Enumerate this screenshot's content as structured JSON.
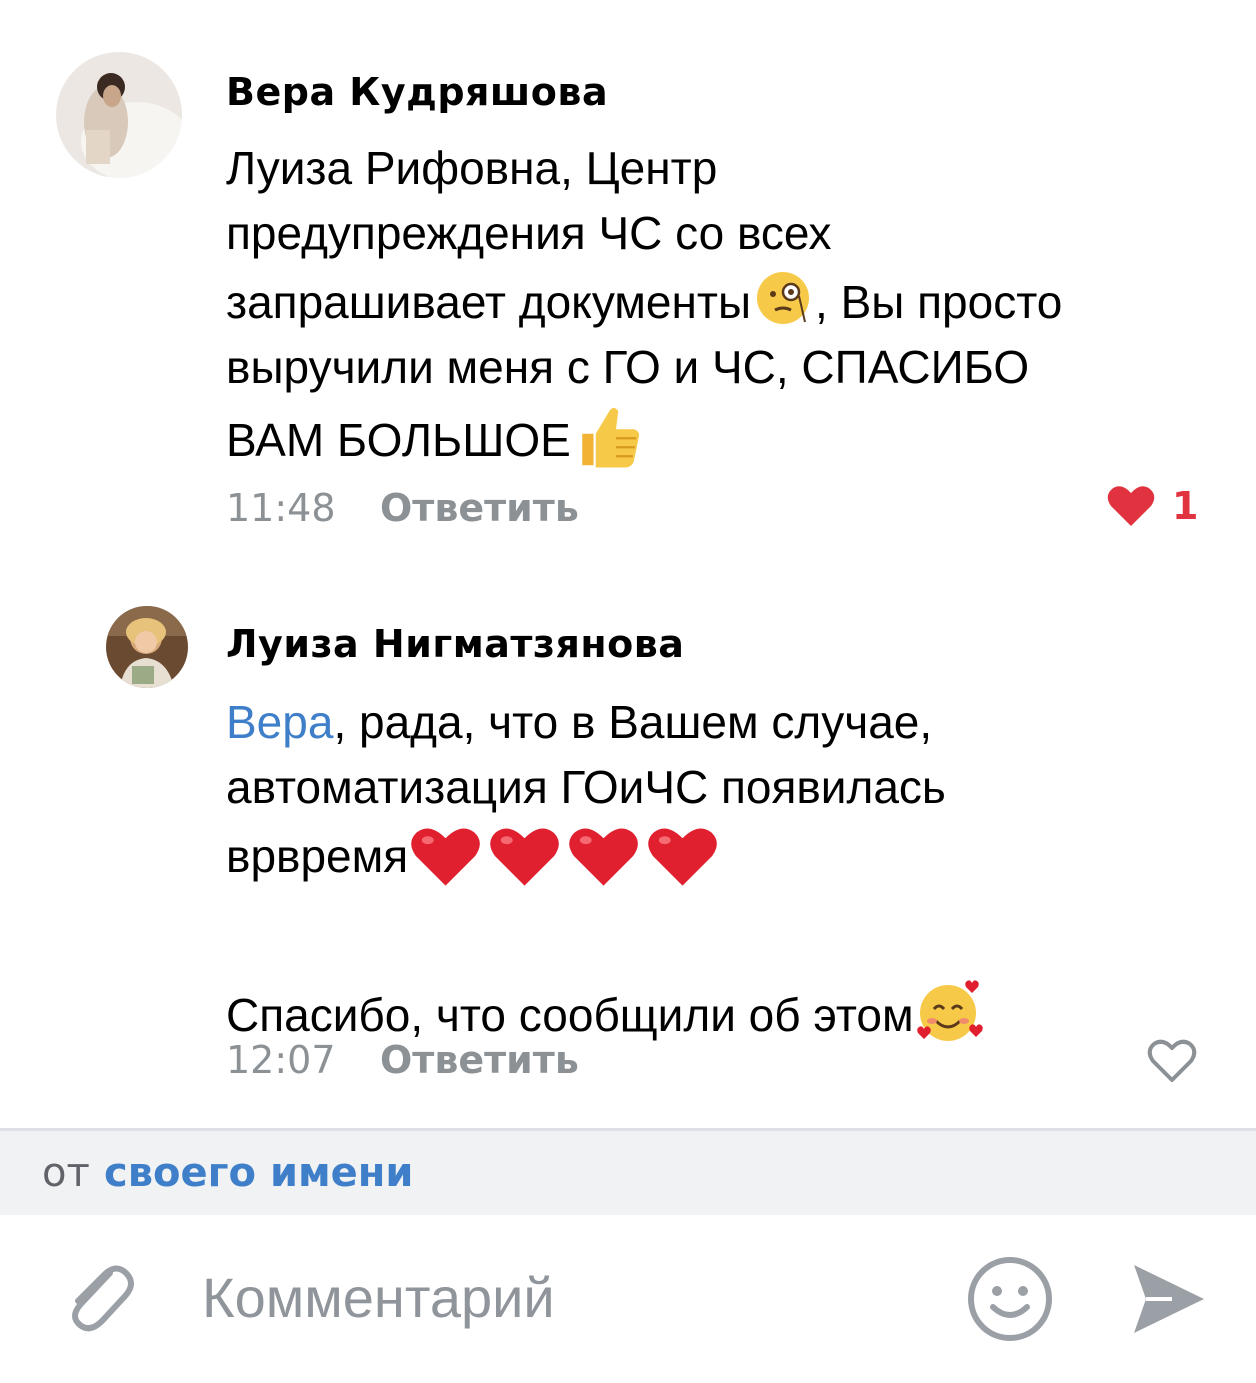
{
  "comments": [
    {
      "author": "Вера Кудряшова",
      "lines": [
        "Луиза Рифовна, Центр",
        "предупреждения ЧС со всех",
        "запрашивает документы",
        ", Вы просто",
        "выручили меня с ГО и ЧС, СПАСИБО",
        "ВАМ БОЛЬШОЕ"
      ],
      "time": "11:48",
      "reply_label": "Ответить",
      "like_count": "1",
      "liked": true,
      "emojis": [
        "face-with-monocle",
        "thumbs-up"
      ]
    },
    {
      "author": "Луиза Нигматзянова",
      "mention": "Вера",
      "lines": [
        ", рада, что в Вашем случае,",
        "автоматизация ГОиЧС появилась",
        "врвремя"
      ],
      "second_paragraph": "Спасибо, что сообщили об этом",
      "time": "12:07",
      "reply_label": "Ответить",
      "liked": false,
      "emojis": [
        "red-heart",
        "red-heart",
        "red-heart",
        "red-heart",
        "smiling-face-with-hearts"
      ]
    }
  ],
  "post_as": {
    "prefix": "от",
    "name": "своего имени"
  },
  "composer": {
    "placeholder": "Комментарий"
  },
  "colors": {
    "accent": "#3f7fc9",
    "like_red": "#e0333f",
    "meta_gray": "#8c9196",
    "bar_bg": "#f1f2f4"
  }
}
